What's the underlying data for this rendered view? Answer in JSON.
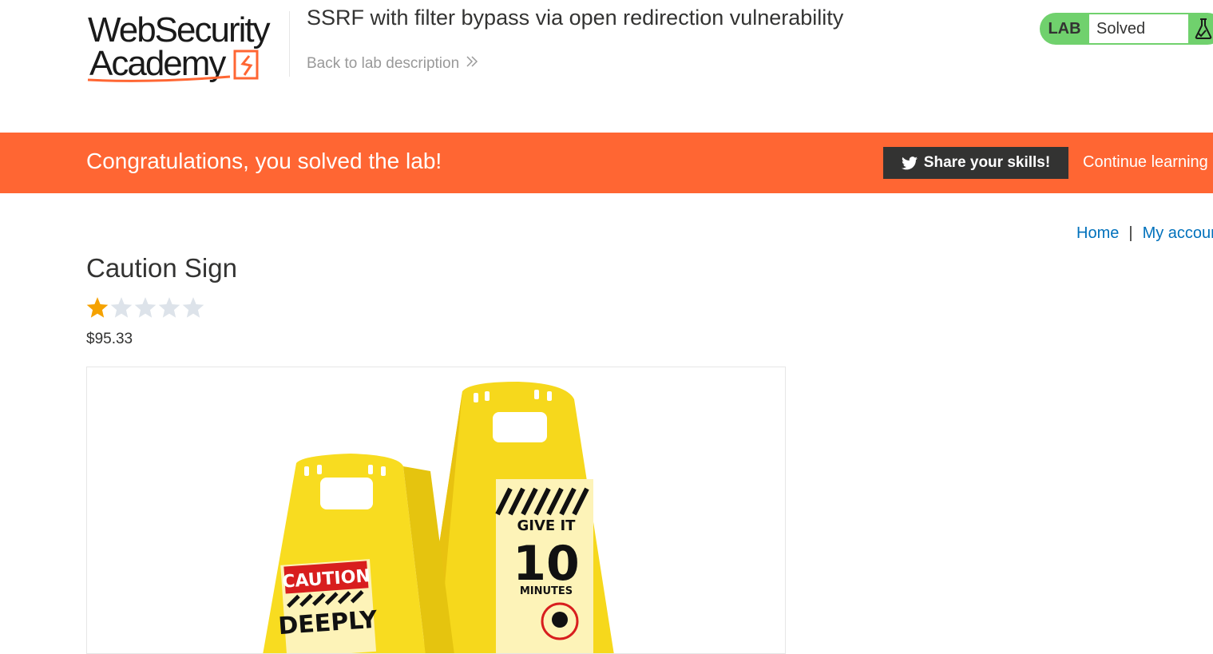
{
  "header": {
    "logo_line1": "WebSecurity",
    "logo_line2": "Academy",
    "lab_title": "SSRF with filter bypass via open redirection vulnerability",
    "back_link": "Back to lab description",
    "lab_badge": "LAB",
    "lab_status": "Solved",
    "status_color": "#70d16d"
  },
  "banner": {
    "message": "Congratulations, you solved the lab!",
    "share_button": "Share your skills!",
    "continue_link": "Continue learning",
    "color": "#ff6633"
  },
  "nav": {
    "home": "Home",
    "separator": "|",
    "account": "My account"
  },
  "product": {
    "title": "Caution Sign",
    "rating_stars": 1,
    "rating_max": 5,
    "price": "$95.33",
    "image_sign_left_top": "CAUTION",
    "image_sign_left_text": "DEEPLY",
    "image_sign_right_top": "GIVE IT",
    "image_sign_right_number": "10",
    "image_sign_right_unit": "MINUTES"
  },
  "icons": {
    "logo": "websecurity-academy-logo",
    "back": "double-chevron-right-icon",
    "flask": "flask-icon",
    "twitter": "twitter-icon",
    "star": "star-icon"
  }
}
